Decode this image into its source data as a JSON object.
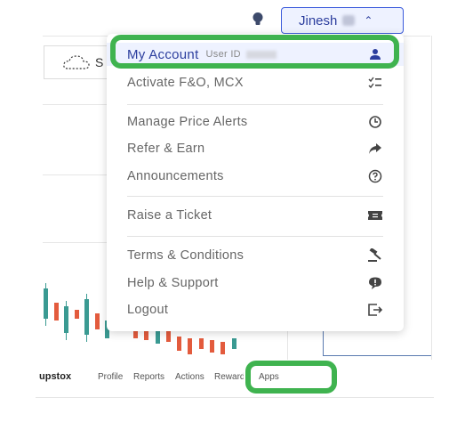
{
  "header": {
    "user_name": "Jinesh",
    "bulb_icon": "lightbulb-icon",
    "chevron_icon": "chevron-up-icon"
  },
  "background": {
    "cloud_label": "S"
  },
  "menu": {
    "account": {
      "label": "My Account",
      "sub_label": "User ID",
      "icon": "user-icon"
    },
    "items": [
      {
        "label": "Activate F&O, MCX",
        "icon": "checklist-icon"
      },
      {
        "label": "Manage Price Alerts",
        "icon": "clock-alert-icon"
      },
      {
        "label": "Refer & Earn",
        "icon": "share-arrow-icon"
      },
      {
        "label": "Announcements",
        "icon": "help-circle-icon"
      },
      {
        "label": "Raise a Ticket",
        "icon": "ticket-icon"
      },
      {
        "label": "Terms & Conditions",
        "icon": "gavel-icon"
      },
      {
        "label": "Help & Support",
        "icon": "chat-bubble-icon"
      },
      {
        "label": "Logout",
        "icon": "logout-icon"
      }
    ]
  },
  "bottom_nav": {
    "brand": "upstox",
    "items": [
      "Profile",
      "Reports",
      "Actions",
      "Rewards",
      "Apps"
    ]
  },
  "colors": {
    "accent": "#2c3e9e",
    "highlight": "#3fb34f",
    "candle_up": "#3a9a92",
    "candle_down": "#e35b3d"
  }
}
